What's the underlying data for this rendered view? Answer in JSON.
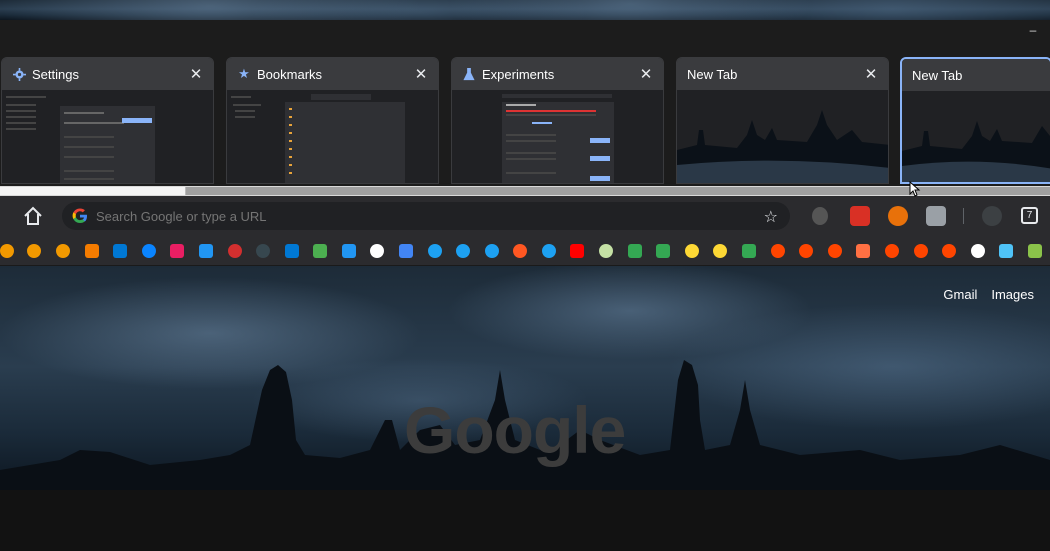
{
  "window": {
    "minimize_icon": "minimize-icon"
  },
  "tabs": [
    {
      "title": "Settings",
      "icon": "gear-icon",
      "active": false
    },
    {
      "title": "Bookmarks",
      "icon": "star-icon",
      "active": false
    },
    {
      "title": "Experiments",
      "icon": "flask-icon",
      "active": false
    },
    {
      "title": "New Tab",
      "icon": "none",
      "active": false
    },
    {
      "title": "New Tab",
      "icon": "none",
      "active": true
    }
  ],
  "toolbar": {
    "omnibox_placeholder": "Search Google or type a URL",
    "tab_count": "7"
  },
  "ntp": {
    "gmail_label": "Gmail",
    "images_label": "Images",
    "logo_text": "Google"
  },
  "colors": {
    "accent": "#8ab4f8",
    "toolbar_bg": "#2b2b2e",
    "omnibox_bg": "#202124"
  }
}
